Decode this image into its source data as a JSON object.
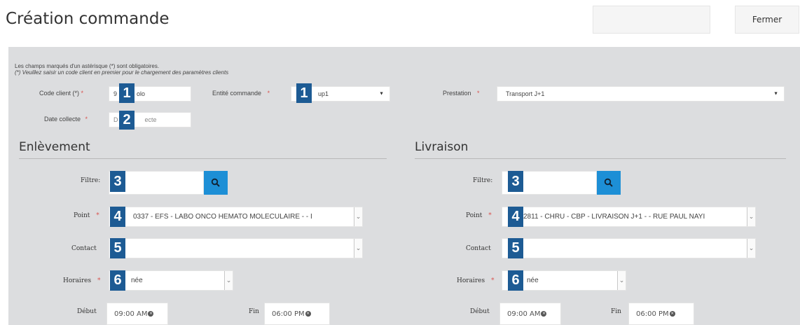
{
  "title": "Création commande",
  "header_buttons": {
    "save_label": "",
    "close_label": "Fermer"
  },
  "notes": {
    "mandatory": "Les champs marqués d'un astérisque (*) sont obligatoires.",
    "client_first": "(*) Veuillez saisir un code client en premier pour le chargement des paramètres clients"
  },
  "form": {
    "client_code": {
      "label": "Code client (*)",
      "required": "*",
      "value": "9",
      "value_tail": "olo"
    },
    "entity": {
      "label": "Entité commande",
      "required": "*",
      "value": "up1"
    },
    "prestation": {
      "label": "Prestation",
      "required": "*",
      "value": "Transport J+1"
    },
    "collection_date": {
      "label": "Date collecte",
      "required": "*",
      "placeholder_left": "D",
      "placeholder_right": "ecte"
    }
  },
  "pickup": {
    "title": "Enlèvement",
    "filter_label": "Filtre:",
    "point_label": "Point",
    "point_required": "*",
    "point_value": "0337 - EFS - LABO ONCO HEMATO MOLECULAIRE - - I",
    "contact_label": "Contact",
    "hours_label": "Horaires",
    "hours_required": "*",
    "hours_value": "née",
    "start_label": "Début",
    "start_value": "09:00 AM",
    "end_label": "Fin",
    "end_value": "06:00 PM"
  },
  "delivery": {
    "title": "Livraison",
    "filter_label": "Filtre:",
    "point_label": "Point",
    "point_required": "*",
    "point_value": "2811 - CHRU - CBP - LIVRAISON J+1 - - RUE PAUL NAYI",
    "contact_label": "Contact",
    "hours_label": "Horaires",
    "hours_required": "*",
    "hours_value": "née",
    "start_label": "Début",
    "start_value": "09:00 AM",
    "end_label": "Fin",
    "end_value": "06:00 PM"
  },
  "badges": {
    "b1": "1",
    "b2": "2",
    "b3": "3",
    "b4": "4",
    "b5": "5",
    "b6": "6"
  },
  "colors": {
    "badge": "#1d5b94",
    "search_button": "#1d8fd6",
    "required_star": "#d9534f",
    "panel_bg": "#dcdddf"
  },
  "icons": {
    "search": "search-icon",
    "caret": "caret-down-icon",
    "clear": "clear-icon"
  }
}
